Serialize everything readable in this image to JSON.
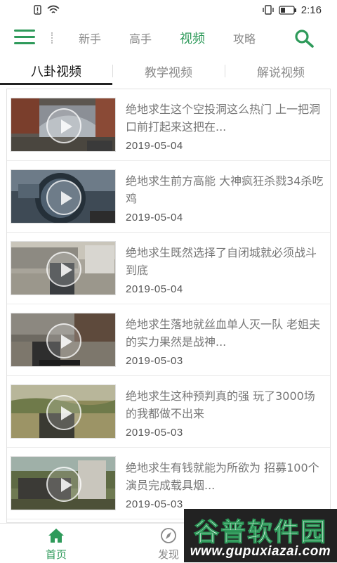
{
  "status_bar": {
    "time": "2:16"
  },
  "top_nav": {
    "tabs": [
      {
        "label": "新手",
        "active": false
      },
      {
        "label": "高手",
        "active": false
      },
      {
        "label": "视频",
        "active": true
      },
      {
        "label": "攻略",
        "active": false
      }
    ],
    "accent_color": "#2e9a5a"
  },
  "sub_tabs": [
    {
      "label": "八卦视频",
      "active": true
    },
    {
      "label": "教学视频",
      "active": false
    },
    {
      "label": "解说视频",
      "active": false
    }
  ],
  "videos": [
    {
      "title": "绝地求生这个空投洞这么热门 上一把洞口前打起来这把在...",
      "date": "2019-05-04"
    },
    {
      "title": "绝地求生前方高能 大神疯狂杀戮34杀吃鸡",
      "date": "2019-05-04"
    },
    {
      "title": "绝地求生既然选择了自闭城就必须战斗到底",
      "date": "2019-05-04"
    },
    {
      "title": "绝地求生落地就丝血单人灭一队 老姐夫的实力果然是战神...",
      "date": "2019-05-03"
    },
    {
      "title": "绝地求生这种预判真的强 玩了3000场的我都做不出来",
      "date": "2019-05-03"
    },
    {
      "title": "绝地求生有钱就能为所欲为 招募100个演员完成载具烟...",
      "date": "2019-05-03"
    }
  ],
  "bottom_nav": [
    {
      "label": "首页",
      "icon": "home-icon",
      "active": true
    },
    {
      "label": "发现",
      "icon": "compass-icon",
      "active": false
    }
  ],
  "watermark": {
    "text": "谷普软件园",
    "url": "www.gupuxiazai.com"
  }
}
